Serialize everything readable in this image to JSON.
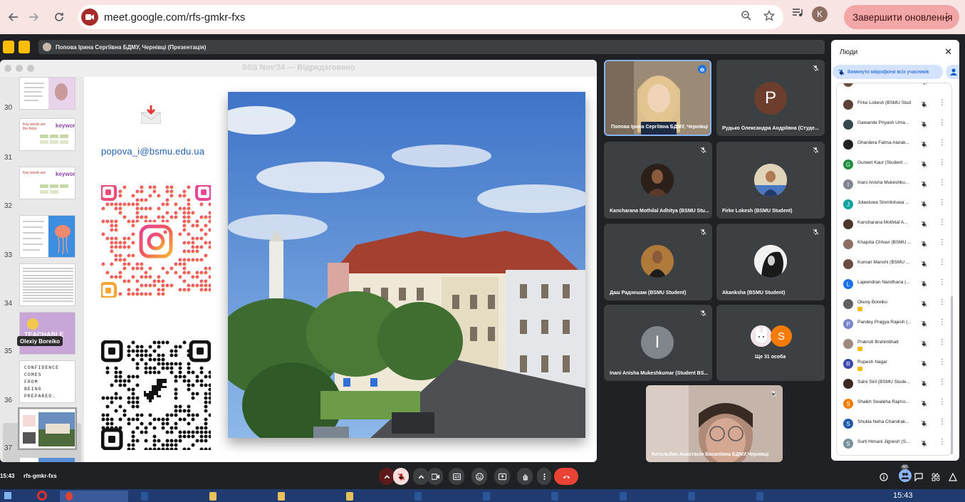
{
  "browser": {
    "url": "meet.google.com/rfs-gmkr-fxs",
    "profile_initial": "K",
    "update_button_label": "Завершити оновлення"
  },
  "meet": {
    "presenter_label": "Попова Ірина Сергіївна БДМУ, Чернівці (Презентація)",
    "presentation_title": "SSS Nov'24 — Відредаговано",
    "time": "15:43",
    "meeting_code": "rfs-gmkr-fxs",
    "participant_count_badge": "40"
  },
  "slides": {
    "thumbnails": [
      {
        "num": "30"
      },
      {
        "num": "31"
      },
      {
        "num": "32"
      },
      {
        "num": "33"
      },
      {
        "num": "34"
      },
      {
        "num": "35"
      },
      {
        "num": "36"
      },
      {
        "num": "37"
      }
    ],
    "thumb_31_title": "Key words are the Keys",
    "thumb_31_badge": "keywords",
    "thumb_35_text": "TEACHABLE",
    "thumb_36_text": "CONFIDENCE COMES FROM BEING PREPARED.",
    "olexiy_tag": "Olexiy Boreiko",
    "slide_email": "popova_i@bsmu.edu.ua"
  },
  "tiles": [
    {
      "name": "Попова Ірина Сергіївна БДМУ, Чернівці"
    },
    {
      "name": "Рудько Олександра Андріївна (Студе...",
      "initial": "P"
    },
    {
      "name": "Kancharana Mothilal Adhitya (BSMU Stu..."
    },
    {
      "name": "Firke Lokesh (BSMU Student)"
    },
    {
      "name": "Даш Радхешам (BSMU Student)"
    },
    {
      "name": "Akanksha (BSMU Student)"
    },
    {
      "name": "Inani Anisha Mukeshkumar (Student BS...",
      "initial": "I"
    },
    {
      "name": "Ще 31 особа",
      "initial": "S"
    },
    {
      "name": "Котельбан Анастасія Василівна БДМУ,Чернівці"
    }
  ],
  "people_panel": {
    "title": "Люди",
    "mute_all_label": "Вимкнути мікрофони всіх учасників",
    "people": [
      {
        "name": "Firke Lokesh (BSMU Stud...",
        "color": "#5d4037"
      },
      {
        "name": "Gawande Priyash Uma...",
        "color": "#37474f"
      },
      {
        "name": "Ghardera Fatma Alarak...",
        "color": "#212121"
      },
      {
        "name": "Guneet Kaur (Student ...",
        "initial": "G",
        "color": "#1e8e3e"
      },
      {
        "name": "Inani Anisha Mukeshku...",
        "initial": "I",
        "color": "#80868b"
      },
      {
        "name": "Jolaoluwa Sinmiloluwa ...",
        "initial": "J",
        "color": "#12a39e"
      },
      {
        "name": "Kancharana Mothilal A...",
        "color": "#4e342e"
      },
      {
        "name": "Khajotia Chhavi (BSMU ...",
        "color": "#8d6e63"
      },
      {
        "name": "Kumari Manshi (BSMU ...",
        "color": "#6d4c41"
      },
      {
        "name": "Lajeendran Nandhana (...",
        "initial": "L",
        "color": "#1a73e8"
      },
      {
        "name": "Olexiy Boreiko",
        "color": "#616161",
        "hand": true
      },
      {
        "name": "Pandey Pragya Rajesh (...",
        "initial": "P",
        "color": "#7986cb"
      },
      {
        "name": "Prakruti Brahmbhatt",
        "color": "#a1887f",
        "hand": true
      },
      {
        "name": "Rupesh Nagar",
        "initial": "R",
        "color": "#3949ab",
        "hand": true
      },
      {
        "name": "Salni Siril (BSMU Stude...",
        "color": "#3e2723"
      },
      {
        "name": "Shaikh Swaleha Rajmo...",
        "initial": "S",
        "color": "#f57c00"
      },
      {
        "name": "Shukla Neha Chandrak...",
        "initial": "S",
        "color": "#1e5aa8"
      },
      {
        "name": "Surti Himani Jignesh (S...",
        "initial": "S",
        "color": "#78909c"
      }
    ]
  },
  "taskbar": {
    "time": "15:43"
  }
}
